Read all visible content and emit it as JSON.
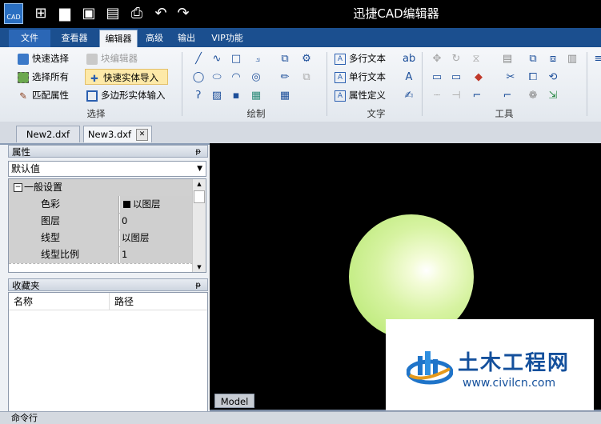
{
  "window": {
    "title": "迅捷CAD编辑器"
  },
  "logo": {
    "text": "CAD"
  },
  "quick_access": [
    "new-icon",
    "open-icon",
    "save-icon",
    "saveas-icon",
    "print-icon",
    "undo-icon",
    "redo-icon"
  ],
  "menu": {
    "tabs": [
      {
        "label": "文件"
      },
      {
        "label": "查看器"
      },
      {
        "label": "编辑器"
      },
      {
        "label": "高级"
      },
      {
        "label": "输出"
      },
      {
        "label": "VIP功能"
      }
    ],
    "active": "编辑器"
  },
  "ribbon": {
    "select_group": {
      "label": "选择",
      "items": [
        {
          "label": "快速选择"
        },
        {
          "label": "块编辑器"
        },
        {
          "label": "选择所有"
        },
        {
          "label": "快速实体导入"
        },
        {
          "label": "匹配属性"
        },
        {
          "label": "多边形实体输入"
        }
      ]
    },
    "draw_group": {
      "label": "绘制"
    },
    "text_group": {
      "label": "文字",
      "items": [
        {
          "label": "多行文本"
        },
        {
          "label": "单行文本"
        },
        {
          "label": "属性定义"
        }
      ]
    },
    "tools_group": {
      "label": "工具"
    }
  },
  "doc_tabs": [
    {
      "label": "New2.dxf"
    },
    {
      "label": "New3.dxf"
    }
  ],
  "properties": {
    "title": "属性",
    "selected": "默认值",
    "section": "一般设置",
    "rows": [
      {
        "key": "色彩",
        "value": "以图层"
      },
      {
        "key": "图层",
        "value": "0"
      },
      {
        "key": "线型",
        "value": "以图层"
      },
      {
        "key": "线型比例",
        "value": "1"
      }
    ]
  },
  "favorites": {
    "title": "收藏夹",
    "columns": [
      "名称",
      "路径"
    ]
  },
  "canvas": {
    "model_tab": "Model",
    "background": "#000000"
  },
  "command": {
    "label": "命令行"
  },
  "watermark": {
    "name": "土木工程网",
    "url": "www.civilcn.com"
  },
  "colors": {
    "titlebar": "#000000",
    "menubar": "#1b4f8f",
    "accent": "#2b67b6"
  }
}
